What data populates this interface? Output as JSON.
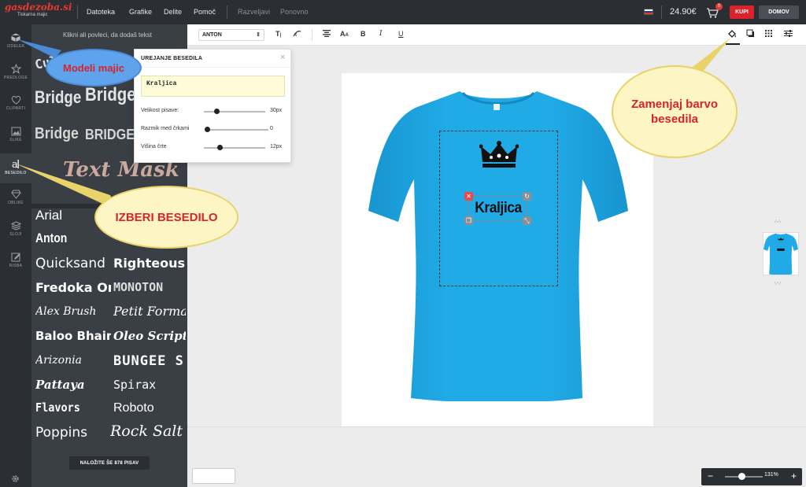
{
  "header": {
    "logo_text": "gasdezoba.si",
    "logo_subtitle": "Tiskarna majic",
    "menu": [
      "Datoteka",
      "Grafike",
      "Delite",
      "Pomoč"
    ],
    "undo_label": "Razveljavi",
    "redo_label": "Ponovno",
    "price": "24.90€",
    "cart_count": "0",
    "buy_label": "KUPI",
    "home_label": "DOMOV"
  },
  "rail": {
    "items": [
      "IZDELEK",
      "PREDLOGE",
      "CLIPARTI",
      "SLIKE",
      "BESEDILO",
      "OBLIKE",
      "SLOJI",
      "RISBA"
    ],
    "active": "BESEDILO"
  },
  "panel": {
    "hint": "Klikni ali povleci, da dodaš tekst",
    "art_samples": [
      "Cult",
      "Bridge",
      "Bridge",
      "Bridge",
      "BRIDGE",
      "Text Mask"
    ],
    "fonts": [
      "Arial",
      "Anton",
      "Quicksand",
      "Righteous",
      "Fredoka One",
      "MONOTON",
      "Alex Brush",
      "Petit Formal",
      "Oleo Script Sw",
      "Baloo Bhaina",
      "Arizonia",
      "BUNGEE S",
      "Pattaya",
      "Spirax",
      "Flavors",
      "Roboto",
      "Poppins",
      "Rock Salt"
    ],
    "more_label": "NALOŽITE ŠE 878 PISAV"
  },
  "toolbar": {
    "font_name": "ANTON"
  },
  "dialog": {
    "title": "UREJANJE BESEDILA",
    "text_value": "Kraljica",
    "font_size_label": "Velikost pisave:",
    "font_size_value": "30px",
    "font_size_level": 0.2,
    "letter_spacing_label": "Razmik med črkami",
    "letter_spacing_value": "0",
    "letter_spacing_level": 0.0,
    "line_height_label": "Višina črte",
    "line_height_value": "12px",
    "line_height_level": 0.25
  },
  "design": {
    "text": "Kraljica",
    "shirt_color": "#1fa8e4"
  },
  "zoom": {
    "value": "131%"
  },
  "callouts": {
    "models": "Modeli majic",
    "choose_text": "IZBERI BESEDILO",
    "change_color": "Zamenjaj barvo besedila"
  }
}
